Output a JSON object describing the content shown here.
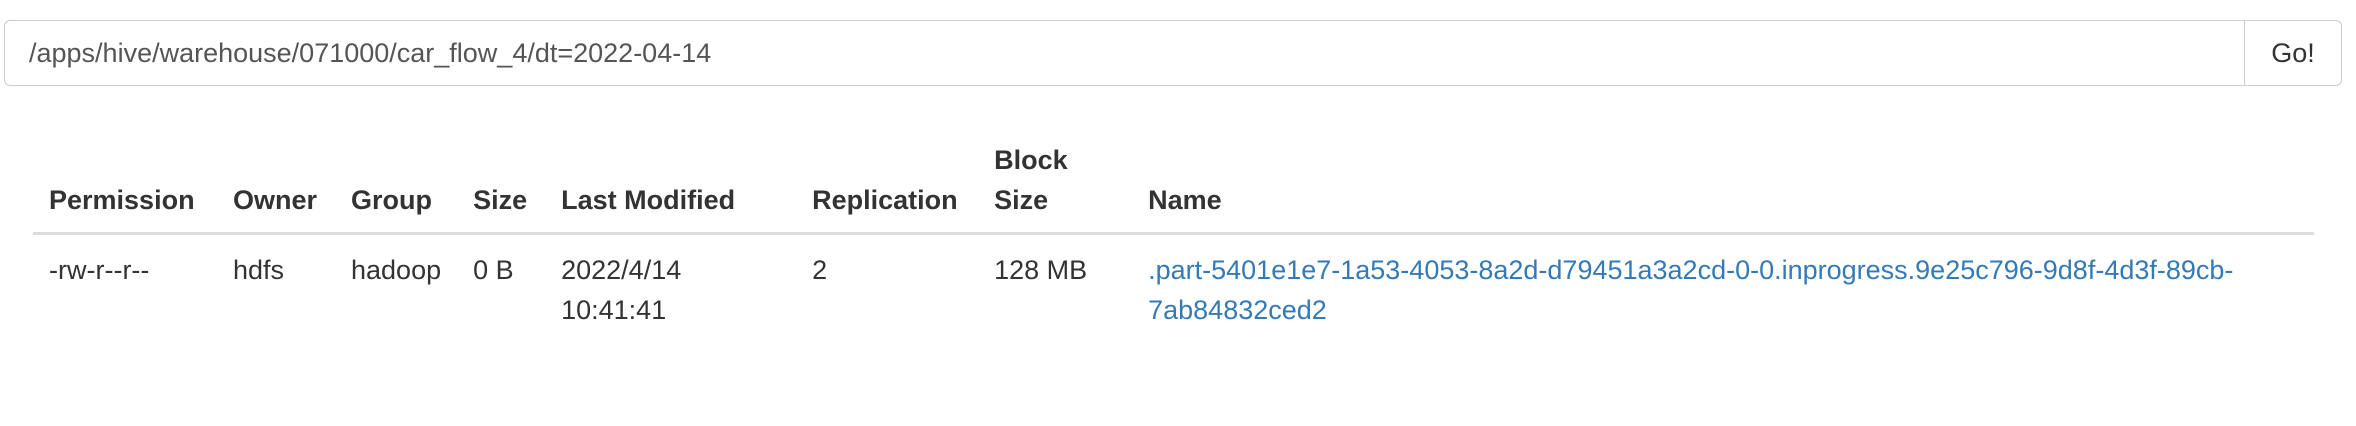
{
  "path_bar": {
    "path_value": "/apps/hive/warehouse/071000/car_flow_4/dt=2022-04-14",
    "go_label": "Go!"
  },
  "table": {
    "headers": {
      "permission": "Permission",
      "owner": "Owner",
      "group": "Group",
      "size": "Size",
      "last_modified": "Last Modified",
      "replication": "Replication",
      "block_size": "Block Size",
      "name": "Name"
    },
    "rows": [
      {
        "permission": "-rw-r--r--",
        "owner": "hdfs",
        "group": "hadoop",
        "size": "0 B",
        "last_modified": "2022/4/14 10:41:41",
        "replication": "2",
        "block_size": "128 MB",
        "name": ".part-5401e1e7-1a53-4053-8a2d-d79451a3a2cd-0-0.inprogress.9e25c796-9d8f-4d3f-89cb-7ab84832ced2"
      }
    ]
  },
  "colors": {
    "link": "#337ab7",
    "text": "#333333",
    "border": "#cccccc"
  }
}
